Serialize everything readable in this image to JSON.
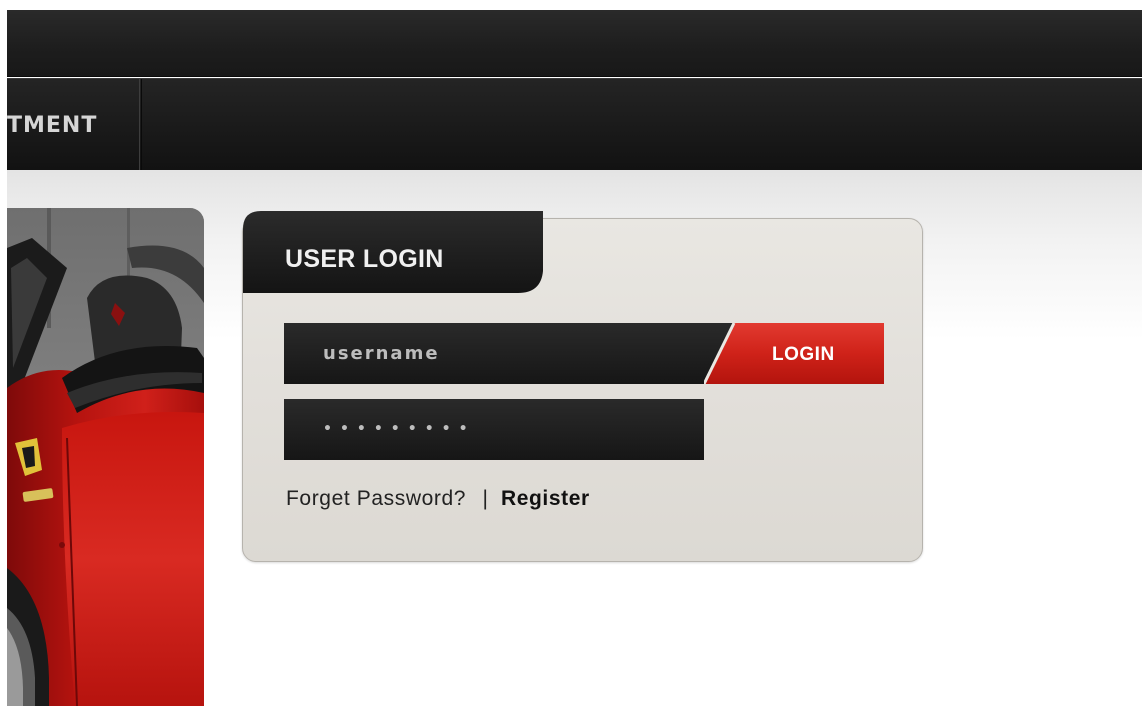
{
  "nav": {
    "items": [
      {
        "label": "TMENT"
      }
    ]
  },
  "login": {
    "title": "USER LOGIN",
    "username_value": "username",
    "password_mask": "•••••••••",
    "login_button": "LOGIN",
    "forgot_link": "Forget Password?",
    "separator": "|",
    "register_link": "Register"
  },
  "colors": {
    "accent_red": "#d12a22",
    "dark_bar": "#1a1a1a",
    "panel_bg": "#e4e1dc"
  }
}
